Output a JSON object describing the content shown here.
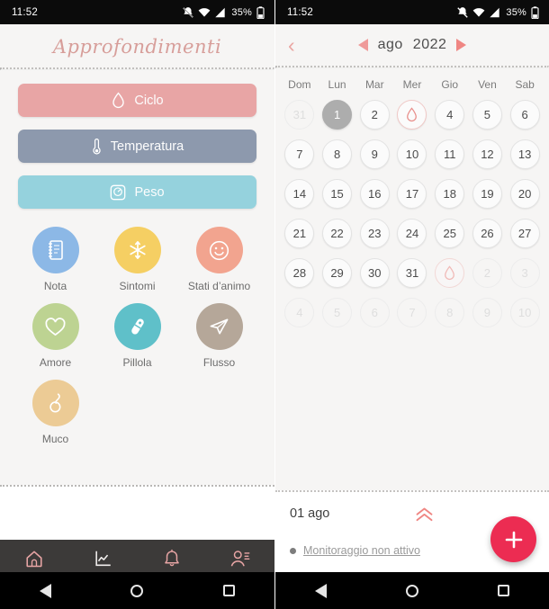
{
  "status_bar": {
    "time": "11:52",
    "battery_pct": "35%",
    "icons": [
      "notifications-silenced-icon",
      "wifi-icon",
      "signal-icon",
      "battery-icon"
    ]
  },
  "colors": {
    "accent_pink": "#e8a5a5",
    "slate": "#8d99ad",
    "light_blue": "#95d2dd",
    "fab": "#ec2c52",
    "nav_bar": "#3c3a39",
    "nav_icon": "#e8a5a5",
    "title": "#d79e9a",
    "background": "#f6f5f4"
  },
  "left_screen": {
    "title": "Approfondimenti",
    "pills": [
      {
        "label": "Ciclo",
        "icon": "drop-icon",
        "color": "#e8a5a5"
      },
      {
        "label": "Temperatura",
        "icon": "thermometer-icon",
        "color": "#8d99ad"
      },
      {
        "label": "Peso",
        "icon": "scale-icon",
        "color": "#95d2dd"
      }
    ],
    "icon_grid": [
      {
        "label": "Nota",
        "icon": "notebook-icon",
        "color": "#8cb8e6"
      },
      {
        "label": "Sintomi",
        "icon": "snowflake-icon",
        "color": "#f5cf63"
      },
      {
        "label": "Stati d’animo",
        "icon": "smiley-icon",
        "color": "#f2a48f"
      },
      {
        "label": "Amore",
        "icon": "heart-icon",
        "color": "#bdd392"
      },
      {
        "label": "Pillola",
        "icon": "pill-icon",
        "color": "#5fc0c9"
      },
      {
        "label": "Flusso",
        "icon": "flow-icon",
        "color": "#b5a799"
      },
      {
        "label": "Muco",
        "icon": "mucus-drop-icon",
        "color": "#eccb95"
      }
    ],
    "bottom_nav": [
      {
        "name": "home",
        "icon": "home-icon",
        "active": true
      },
      {
        "name": "statistics",
        "icon": "chart-icon",
        "active": false
      },
      {
        "name": "reminders",
        "icon": "bell-icon",
        "active": true
      },
      {
        "name": "profile",
        "icon": "person-icon",
        "active": true
      }
    ]
  },
  "right_screen": {
    "back_label": "‹",
    "month": "ago",
    "year": "2022",
    "prev_label": "◀",
    "next_label": "▶",
    "weekdays": [
      "Dom",
      "Lun",
      "Mar",
      "Mer",
      "Gio",
      "Ven",
      "Sab"
    ],
    "days": [
      {
        "label": "31",
        "state": "muted"
      },
      {
        "label": "1",
        "state": "selected"
      },
      {
        "label": "2",
        "state": "normal"
      },
      {
        "label": "",
        "state": "period",
        "icon": "drop-icon"
      },
      {
        "label": "4",
        "state": "normal"
      },
      {
        "label": "5",
        "state": "normal"
      },
      {
        "label": "6",
        "state": "normal"
      },
      {
        "label": "7",
        "state": "normal"
      },
      {
        "label": "8",
        "state": "normal"
      },
      {
        "label": "9",
        "state": "normal"
      },
      {
        "label": "10",
        "state": "normal"
      },
      {
        "label": "11",
        "state": "normal"
      },
      {
        "label": "12",
        "state": "normal"
      },
      {
        "label": "13",
        "state": "normal"
      },
      {
        "label": "14",
        "state": "normal"
      },
      {
        "label": "15",
        "state": "normal"
      },
      {
        "label": "16",
        "state": "normal"
      },
      {
        "label": "17",
        "state": "normal"
      },
      {
        "label": "18",
        "state": "normal"
      },
      {
        "label": "19",
        "state": "normal"
      },
      {
        "label": "20",
        "state": "normal"
      },
      {
        "label": "21",
        "state": "normal"
      },
      {
        "label": "22",
        "state": "normal"
      },
      {
        "label": "23",
        "state": "normal"
      },
      {
        "label": "24",
        "state": "normal"
      },
      {
        "label": "25",
        "state": "normal"
      },
      {
        "label": "26",
        "state": "normal"
      },
      {
        "label": "27",
        "state": "normal"
      },
      {
        "label": "28",
        "state": "normal"
      },
      {
        "label": "29",
        "state": "normal"
      },
      {
        "label": "30",
        "state": "normal"
      },
      {
        "label": "31",
        "state": "normal"
      },
      {
        "label": "",
        "state": "period-muted",
        "icon": "drop-icon"
      },
      {
        "label": "2",
        "state": "muted"
      },
      {
        "label": "3",
        "state": "muted"
      },
      {
        "label": "4",
        "state": "muted"
      },
      {
        "label": "5",
        "state": "muted"
      },
      {
        "label": "6",
        "state": "muted"
      },
      {
        "label": "7",
        "state": "muted"
      },
      {
        "label": "8",
        "state": "muted"
      },
      {
        "label": "9",
        "state": "muted"
      },
      {
        "label": "10",
        "state": "muted"
      }
    ],
    "day_card": {
      "date": "01 ago",
      "expand_icon": "double-chevron-up-icon",
      "status": "Monitoraggio non attivo"
    },
    "fab_label": "+"
  },
  "system_nav": {
    "back": "back-triangle-icon",
    "home": "home-circle-icon",
    "recents": "recents-square-icon"
  }
}
